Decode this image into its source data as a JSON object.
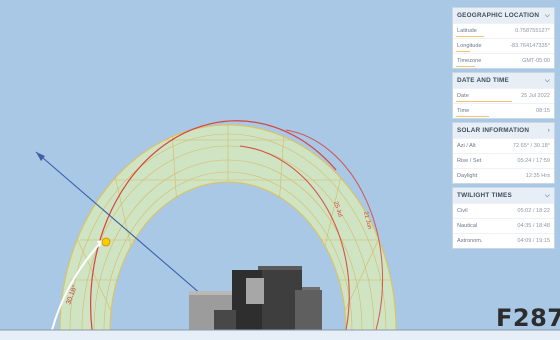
{
  "watermark": "F287",
  "scene": {
    "sun_altitude_label": "30.18°",
    "sun_path_labels": [
      "25 Jul",
      "21 Jun"
    ],
    "sky_color": "#a8c8e6",
    "sun_color": "#ffcc00"
  },
  "panel": {
    "geo": {
      "title": "GEOGRAPHIC LOCATION",
      "rows": [
        {
          "label": "Latitude",
          "value": "0.758755127°",
          "level": 0.3
        },
        {
          "label": "Longitude",
          "value": "-83.764147335°",
          "level": 0.15
        },
        {
          "label": "Timezone",
          "value": "GMT-05:00",
          "level": 0.2
        }
      ]
    },
    "datetime": {
      "title": "DATE AND TIME",
      "rows": [
        {
          "label": "Date",
          "value": "25 Jul 2022",
          "level": 0.6
        },
        {
          "label": "Time",
          "value": "08:15",
          "level": 0.35
        }
      ]
    },
    "solar": {
      "title": "SOLAR INFORMATION",
      "rows": [
        {
          "label": "Azi / Alt",
          "value": "72.65° / 30.18°"
        },
        {
          "label": "Rise / Set",
          "value": "05:24 / 17:59"
        },
        {
          "label": "Daylight",
          "value": "12:35 Hrs"
        }
      ]
    },
    "twilight": {
      "title": "TWILIGHT TIMES",
      "rows": [
        {
          "label": "Civil",
          "value": "05:02 / 18:22"
        },
        {
          "label": "Nautical",
          "value": "04:35 / 18:48"
        },
        {
          "label": "Astronom.",
          "value": "04:09 / 19:15"
        }
      ]
    }
  }
}
